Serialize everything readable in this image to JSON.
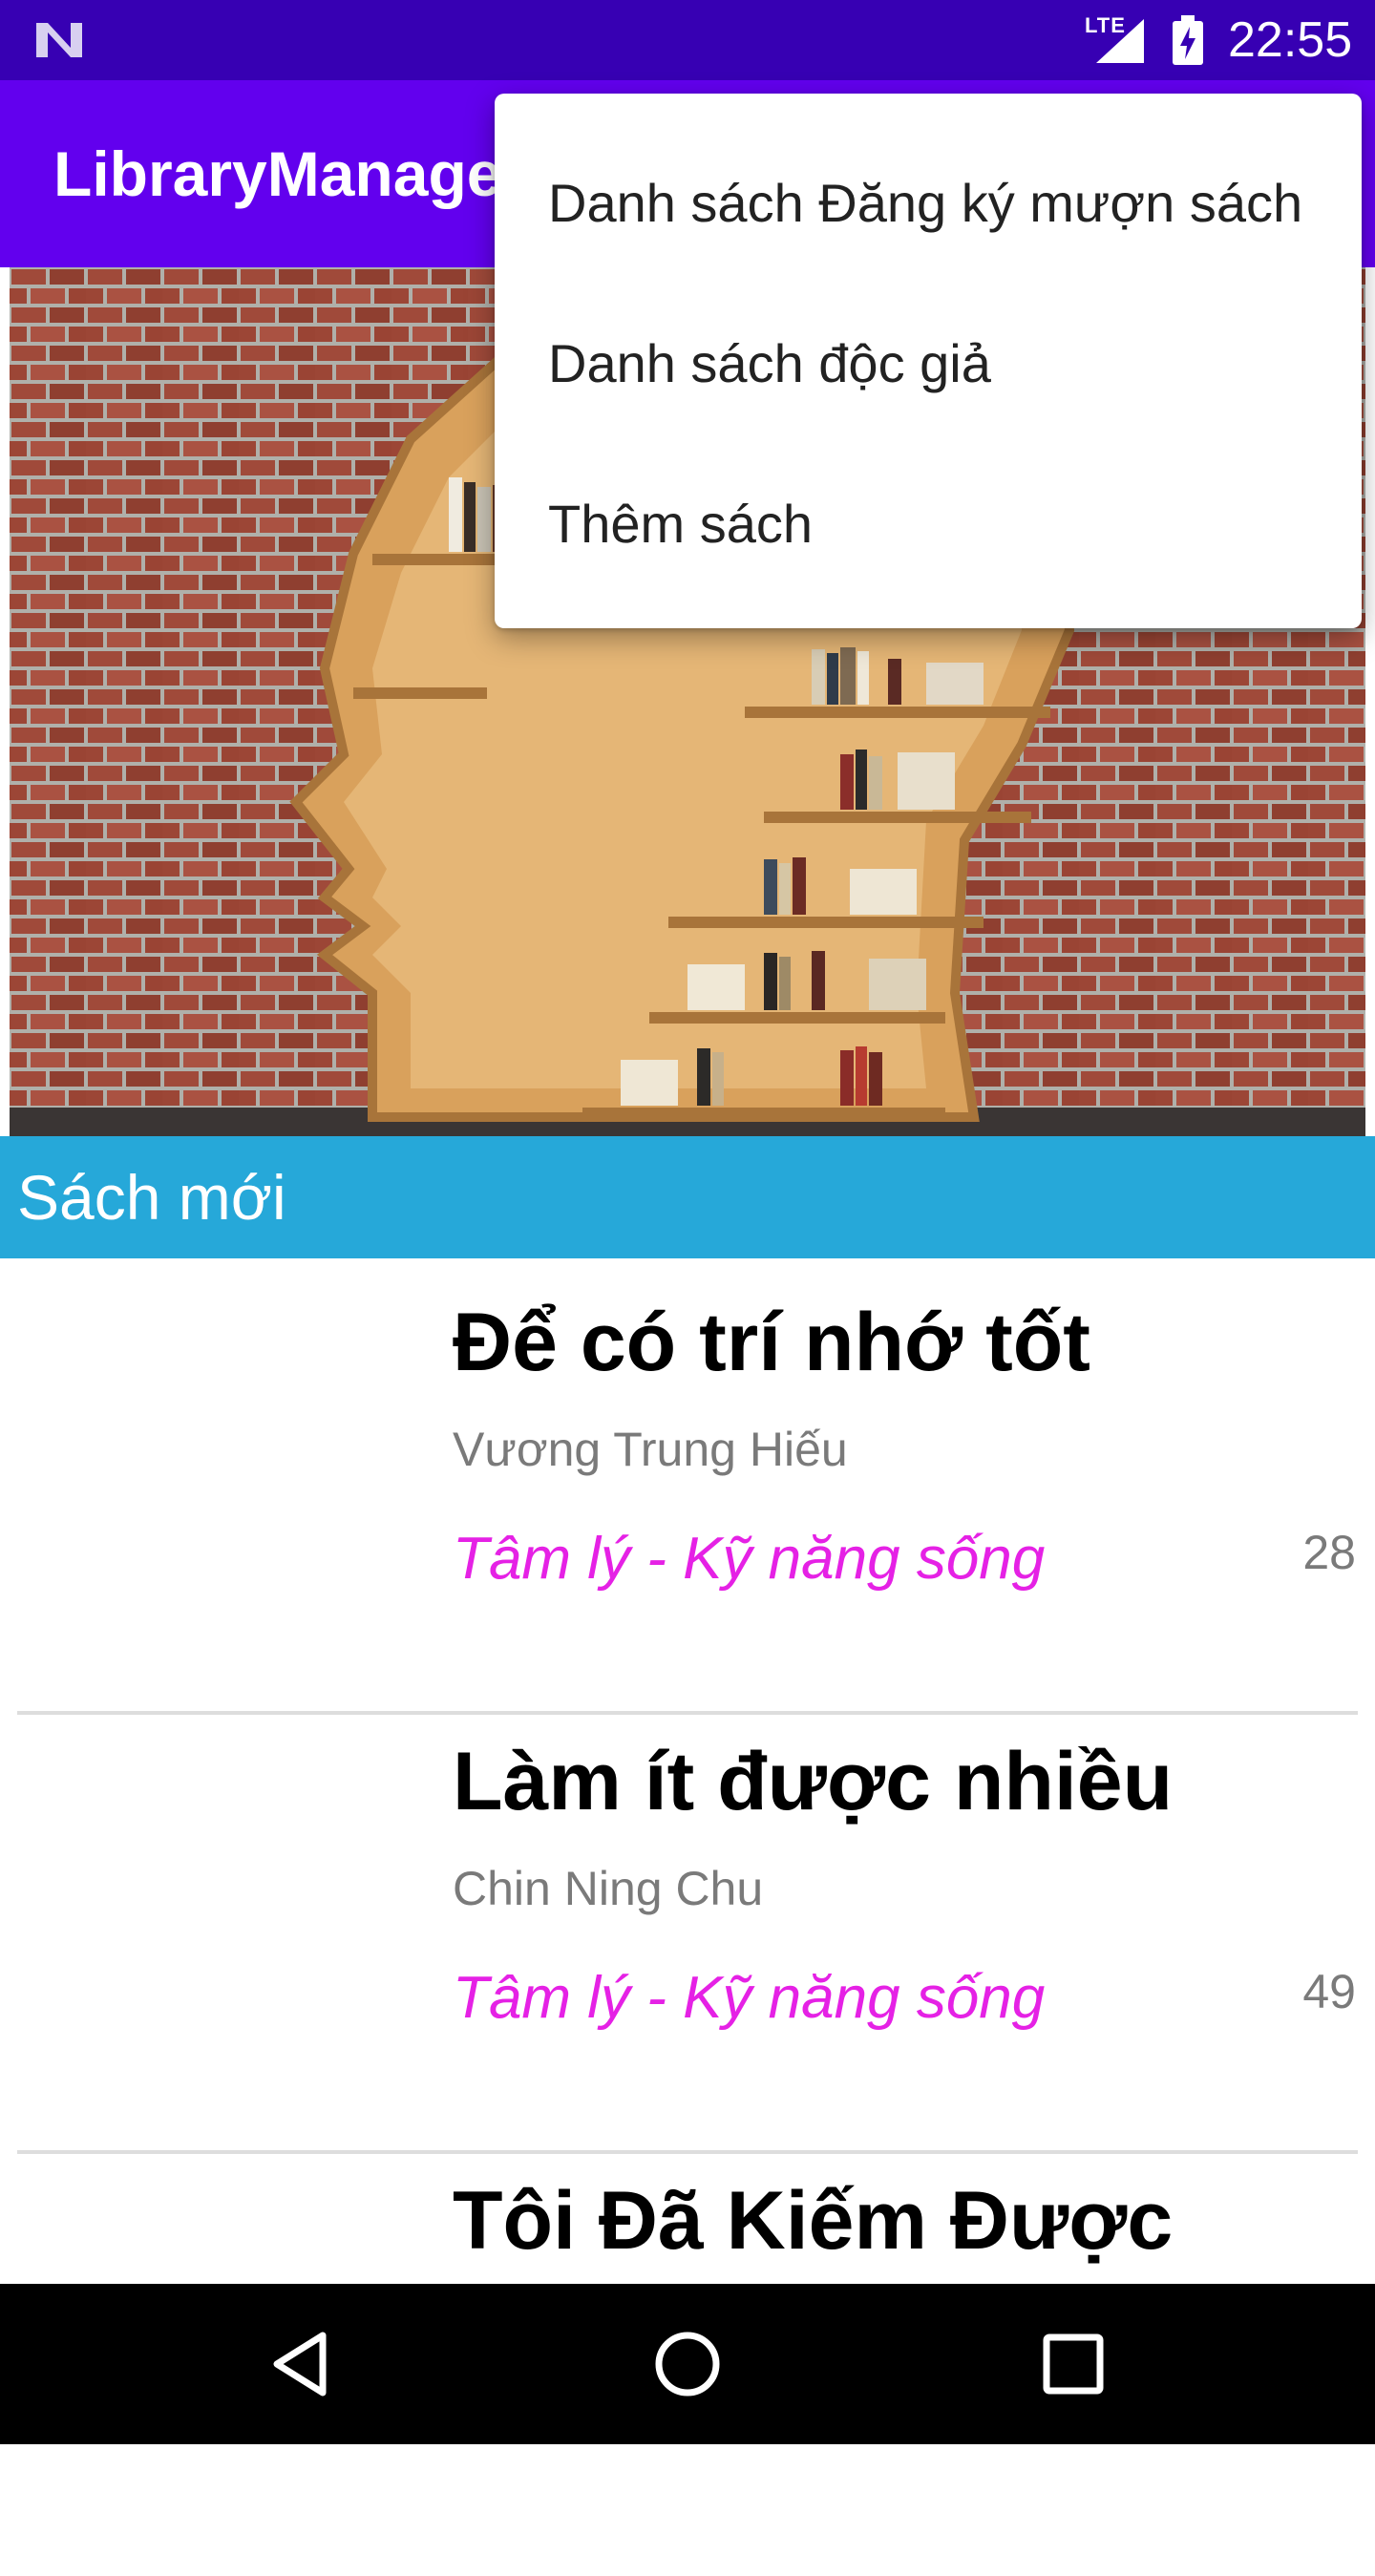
{
  "status_bar": {
    "network": "LTE",
    "time": "22:55"
  },
  "app_bar": {
    "title": "LibraryManager"
  },
  "section": {
    "title": "Sách mới"
  },
  "books": [
    {
      "title": "Để có trí nhớ tốt",
      "author": "Vương Trung Hiếu",
      "category": "Tâm lý - Kỹ năng sống",
      "count": "28"
    },
    {
      "title": "Làm ít được nhiều",
      "author": "Chin Ning Chu",
      "category": "Tâm lý - Kỹ năng sống",
      "count": "49"
    },
    {
      "title": "Tôi Đã Kiếm Được",
      "author": "",
      "category": "",
      "count": ""
    }
  ],
  "overflow_menu": {
    "items": [
      {
        "label": "Danh sách Đăng ký mượn sách"
      },
      {
        "label": "Danh sách độc giả"
      },
      {
        "label": "Thêm sách"
      }
    ]
  },
  "colors": {
    "status_bar": "#3700b3",
    "app_bar": "#6200ee",
    "section_header": "#26a8d9",
    "category_text": "#e521e5"
  },
  "icons": {
    "status": [
      "android-n-logo-icon",
      "signal-icon",
      "battery-charging-icon"
    ],
    "nav": [
      "back-icon",
      "home-icon",
      "recents-icon"
    ]
  }
}
